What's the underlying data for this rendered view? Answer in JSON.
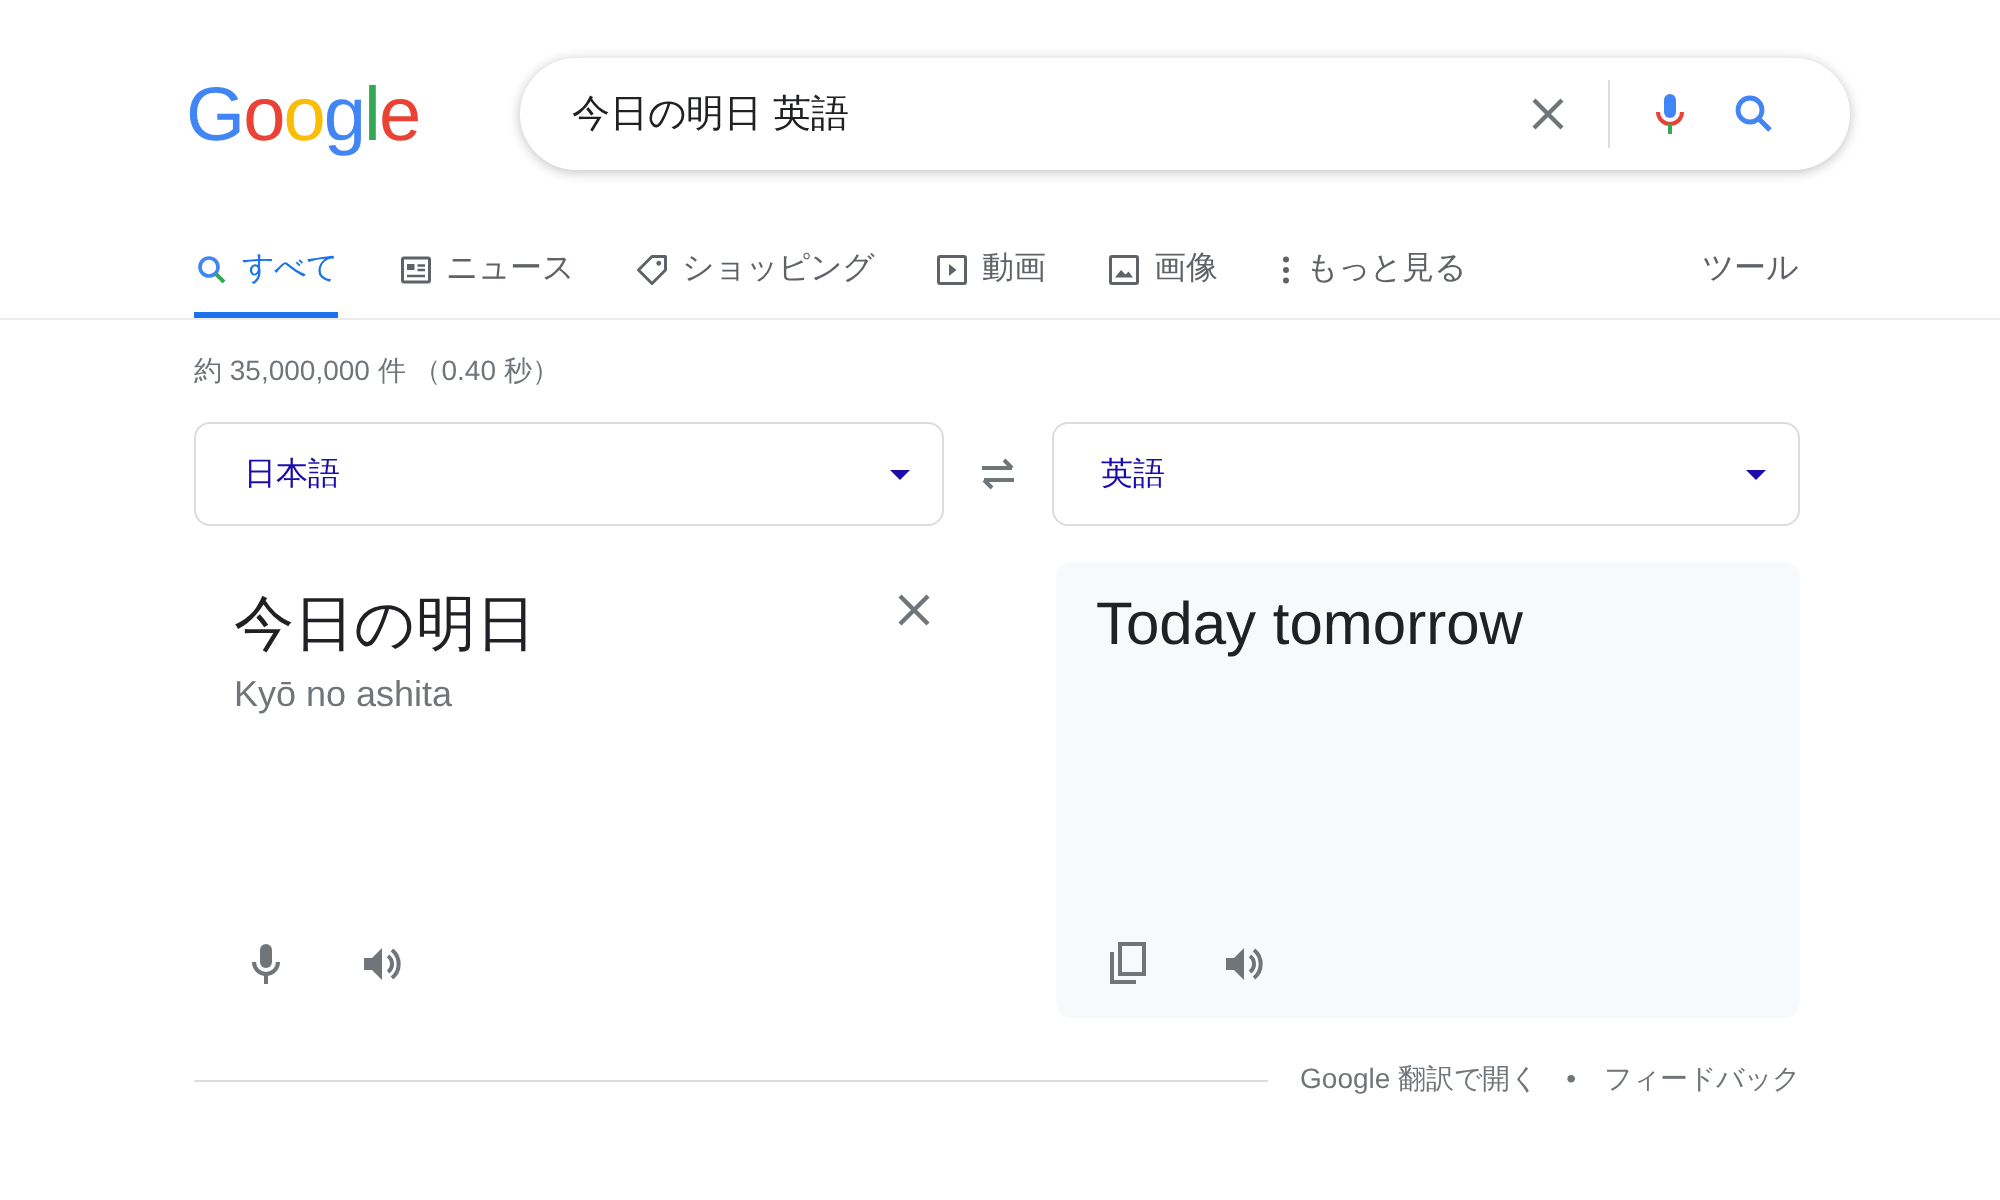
{
  "logo": "Google",
  "search": {
    "value": "今日の明日 英語"
  },
  "tabs": [
    {
      "label": "すべて",
      "kind": "search",
      "selected": true
    },
    {
      "label": "ニュース",
      "kind": "news",
      "selected": false
    },
    {
      "label": "ショッピング",
      "kind": "tag",
      "selected": false
    },
    {
      "label": "動画",
      "kind": "video",
      "selected": false
    },
    {
      "label": "画像",
      "kind": "image",
      "selected": false
    },
    {
      "label": "もっと見る",
      "kind": "more",
      "selected": false
    }
  ],
  "tools": "ツール",
  "result_stats": "約 35,000,000 件 （0.40 秒）",
  "translator": {
    "source_language": "日本語",
    "target_language": "英語",
    "source_text": "今日の明日",
    "romanization": "Kyō no ashita",
    "translation": "Today tomorrow",
    "footer_links": [
      "Google 翻訳で開く",
      "フィードバック"
    ],
    "separator": "•"
  }
}
